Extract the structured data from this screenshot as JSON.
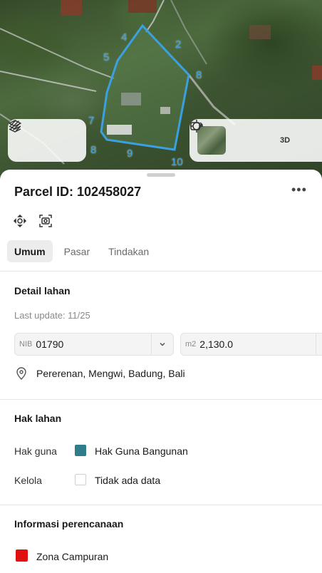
{
  "map": {
    "parcel_vertex_labels": [
      "4",
      "5",
      "2",
      "8",
      "7",
      "8",
      "9",
      "10"
    ],
    "outline_color": "#3aa0e0",
    "controls_left": [
      {
        "icon": "layers-icon"
      },
      {
        "icon": "draw-lines-icon"
      }
    ],
    "controls_right": {
      "thumbnail": "satellite-thumbnail",
      "locate_icon": "crosshair-icon",
      "three_d_label": "3D",
      "rotate_icon": "rotate-icon"
    }
  },
  "sheet": {
    "title": "Parcel ID: 102458027",
    "more_label": "•••",
    "tool_icons": [
      "recenter-icon",
      "camera-scan-icon"
    ],
    "tabs": [
      {
        "label": "Umum",
        "active": true
      },
      {
        "label": "Pasar",
        "active": false
      },
      {
        "label": "Tindakan",
        "active": false
      }
    ],
    "detail": {
      "title": "Detail lahan",
      "last_update": "Last update: 11/25",
      "nib_prefix": "NIB",
      "nib_value": "01790",
      "area_prefix": "m2",
      "area_value": "2,130.0",
      "address": "Pererenan, Mengwi, Badung, Bali"
    },
    "rights": {
      "title": "Hak lahan",
      "rows": [
        {
          "label": "Hak guna",
          "value": "Hak Guna Bangunan",
          "color": "#2f7c8a"
        },
        {
          "label": "Kelola",
          "value": "Tidak ada data",
          "color": "#ffffff"
        }
      ]
    },
    "planning": {
      "title": "Informasi perencanaan",
      "zone": "Zona Campuran",
      "zone_color": "#e01010"
    }
  }
}
